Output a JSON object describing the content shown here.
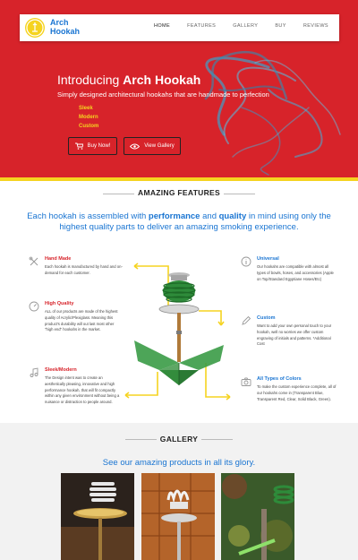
{
  "brand": {
    "name_line1": "Arch",
    "name_line2": "Hookah"
  },
  "nav": {
    "items": [
      {
        "label": "HOME",
        "active": true
      },
      {
        "label": "FEATURES",
        "active": false
      },
      {
        "label": "GALLERY",
        "active": false
      },
      {
        "label": "BUY",
        "active": false
      },
      {
        "label": "REVIEWS",
        "active": false
      }
    ]
  },
  "hero": {
    "title_prefix": "Introducing ",
    "title_bold": "Arch Hookah",
    "subtitle": "Simply designed architectural hookahs that are handmade to perfection",
    "list": [
      "Sleek",
      "Modern",
      "Custom"
    ],
    "buy_button": "Buy Now!",
    "gallery_button": "View Gallery"
  },
  "features": {
    "title": "AMAZING FEATURES",
    "lead_1": "Each hookah is assembled with ",
    "lead_bold_1": "performance",
    "lead_2": " and ",
    "lead_bold_2": "quality",
    "lead_3": " in mind using only the highest quality parts to deliver an amazing smoking experience.",
    "left": [
      {
        "title": "Hand Made",
        "icon": "tools-icon",
        "text": "Each hookah is manufactured by hand and on-demand for each customer."
      },
      {
        "title": "High Quality",
        "icon": "gauge-icon",
        "text": "ALL of our products are made of the highest quality of Acrylic/Plexiglass. Meaning this product's durability will out last most other \"high end\" hookahs in the market."
      },
      {
        "title": "Sleek/Modern",
        "icon": "music-note-icon",
        "text": "The Design intent was to create an aesthetically pleasing, innovative and high performance hookah, that will fit compactly within any given environment without being a nuisance or distraction to people around."
      }
    ],
    "right": [
      {
        "title": "Universal",
        "icon": "info-icon",
        "text": "Our hookahs are compatible with almost all types of bowls, hoses, and accessories (Apple on Top/Standard Egyptiane Hoses/Etc)"
      },
      {
        "title": "Custom",
        "icon": "pencil-icon",
        "text": "Want to add your own personal touch to your hookah, well no worries we offer custom engraving of initials and patterns. *Additional Cost"
      },
      {
        "title": "All Types of Colors",
        "icon": "camera-icon",
        "text": "To make the custom experience complete, all of our hookahs come in (Transparent Blue, Transparent Red, Clear, Solid Black, Green)."
      }
    ]
  },
  "gallery": {
    "title": "GALLERY",
    "lead": "See our amazing products in all its glory."
  },
  "colors": {
    "brand_red": "#d7232a",
    "brand_blue": "#1a75d2",
    "accent_yellow": "#f5d320",
    "product_green": "#2e8b3a"
  }
}
